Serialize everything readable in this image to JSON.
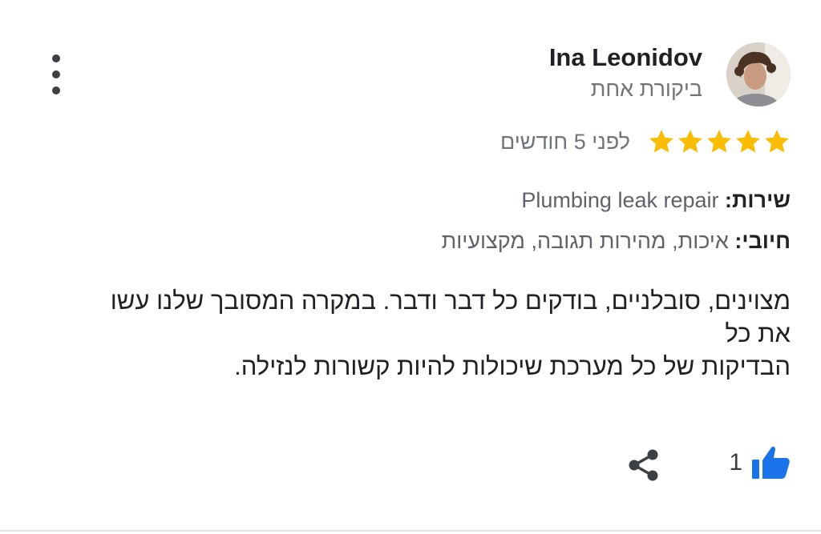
{
  "reviewer": {
    "name": "Ina Leonidov",
    "subtitle": "ביקורת אחת"
  },
  "rating": {
    "stars": 5,
    "max": 5,
    "time": "לפני 5 חודשים"
  },
  "details": {
    "service_label": "שירות:",
    "service_value": "Plumbing leak repair",
    "positive_label": "חיובי:",
    "positive_value": "איכות, מהירות תגובה, מקצועיות"
  },
  "review": {
    "lines": [
      "מצוינים, סובלניים, בודקים כל דבר ודבר. במקרה המסובך שלנו עשו",
      "את כל",
      "הבדיקות של כל מערכת שיכולות להיות קשורות לנזילה."
    ]
  },
  "actions": {
    "like_count": "1"
  },
  "colors": {
    "star": "#fbbc04",
    "like": "#1a73e8"
  }
}
